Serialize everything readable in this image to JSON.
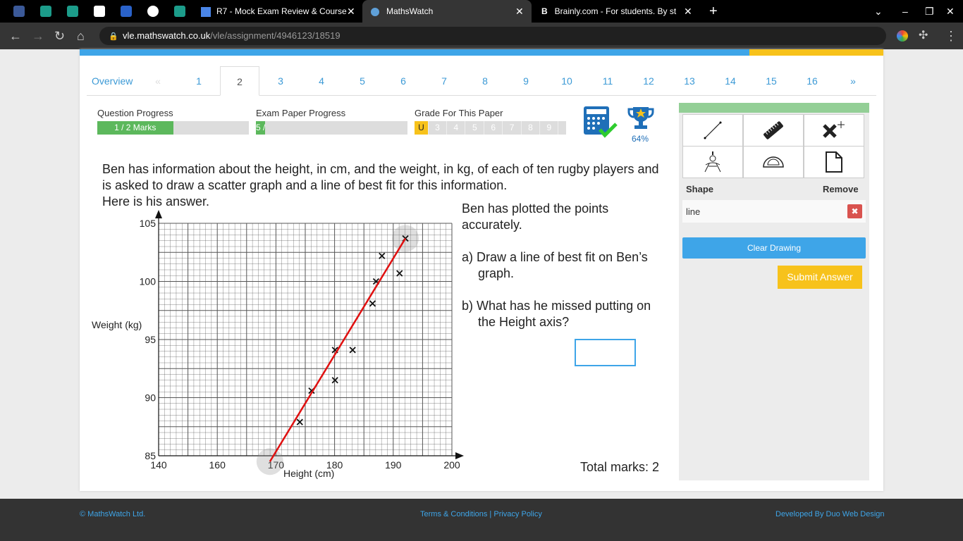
{
  "browser": {
    "tabs": [
      {
        "title": "R7 - Mock Exam Review & Course"
      },
      {
        "title": "MathsWatch",
        "active": true
      },
      {
        "title": "Brainly.com - For students. By st"
      }
    ],
    "url_host": "vle.mathswatch.co.uk",
    "url_path": "/vle/assignment/4946123/18519"
  },
  "nav": {
    "overview": "Overview",
    "prev": "«",
    "questions": [
      "1",
      "2",
      "3",
      "4",
      "5",
      "6",
      "7",
      "8",
      "9",
      "10",
      "11",
      "12",
      "13",
      "14",
      "15",
      "16"
    ],
    "active": "2",
    "next": "»"
  },
  "progress": {
    "question_label": "Question Progress",
    "question_text": "1 / 2 Marks",
    "question_fraction": 0.5,
    "exam_label": "Exam Paper Progress",
    "exam_text": "5 /",
    "exam_fraction": 0.06,
    "grade_label": "Grade For This Paper",
    "grades": [
      "U",
      "3",
      "4",
      "5",
      "6",
      "7",
      "8",
      "9"
    ],
    "current_grade": "U",
    "trophy_percent": "64%"
  },
  "question": {
    "intro": "Ben has information about the height, in cm, and the weight, in kg, of each of ten rugby players and is asked to draw a scatter graph and a line of best fit for this information.",
    "here": "Here is his answer.",
    "plotted": "Ben has plotted the points accurately.",
    "part_a": "a) Draw a line of best fit on Ben’s graph.",
    "part_b": "b) What has he missed putting on the Height axis?",
    "answer_value": "",
    "total_marks": "Total marks: 2"
  },
  "chart_data": {
    "type": "scatter",
    "xlabel": "Height (cm)",
    "ylabel": "Weight (kg)",
    "x_ticks": [
      "140",
      "160",
      "170",
      "180",
      "190",
      "200"
    ],
    "y_ticks": [
      "85",
      "90",
      "95",
      "100",
      "105"
    ],
    "ylim": [
      85,
      105
    ],
    "points": [
      [
        192,
        103.7
      ],
      [
        188,
        102.2
      ],
      [
        191,
        100.7
      ],
      [
        187,
        100
      ],
      [
        186.4,
        98.1
      ],
      [
        180,
        94.1
      ],
      [
        183,
        94.1
      ],
      [
        180,
        91.5
      ],
      [
        176,
        90.6
      ],
      [
        174,
        87.9
      ]
    ],
    "best_fit_line": [
      [
        168.9,
        84.5
      ],
      [
        192,
        103.7
      ]
    ],
    "line_color": "#e01010"
  },
  "tools": {
    "shape_header": "Shape",
    "remove_header": "Remove",
    "shapes": [
      {
        "name": "line"
      }
    ],
    "clear": "Clear Drawing",
    "submit": "Submit Answer"
  },
  "footer": {
    "copyright": "© MathsWatch Ltd.",
    "terms": "Terms & Conditions",
    "sep": " | ",
    "privacy": "Privacy Policy",
    "developer": "Developed By Duo Web Design"
  }
}
